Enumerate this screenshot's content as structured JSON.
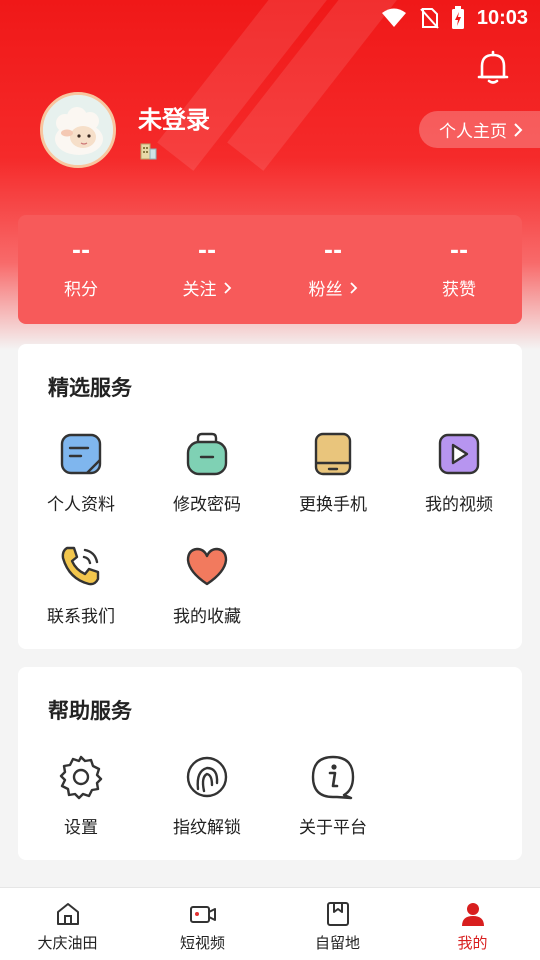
{
  "status_bar": {
    "time": "10:03"
  },
  "profile": {
    "username": "未登录",
    "homepage_label": "个人主页"
  },
  "stats": [
    {
      "value": "--",
      "label": "积分"
    },
    {
      "value": "--",
      "label": "关注"
    },
    {
      "value": "--",
      "label": "粉丝"
    },
    {
      "value": "--",
      "label": "获赞"
    }
  ],
  "featured": {
    "title": "精选服务",
    "items": [
      {
        "label": "个人资料",
        "icon": "profile-card-icon"
      },
      {
        "label": "修改密码",
        "icon": "password-lock-icon"
      },
      {
        "label": "更换手机",
        "icon": "phone-icon"
      },
      {
        "label": "我的视频",
        "icon": "video-play-icon"
      },
      {
        "label": "联系我们",
        "icon": "phone-call-icon"
      },
      {
        "label": "我的收藏",
        "icon": "heart-icon"
      }
    ]
  },
  "help": {
    "title": "帮助服务",
    "items": [
      {
        "label": "设置",
        "icon": "settings-gear-icon"
      },
      {
        "label": "指纹解锁",
        "icon": "fingerprint-icon"
      },
      {
        "label": "关于平台",
        "icon": "info-icon"
      }
    ]
  },
  "tabbar": {
    "items": [
      {
        "label": "大庆油田",
        "icon": "home-icon"
      },
      {
        "label": "短视频",
        "icon": "video-camera-icon"
      },
      {
        "label": "自留地",
        "icon": "bookmark-icon"
      },
      {
        "label": "我的",
        "icon": "user-icon",
        "active": true
      }
    ],
    "active_color": "#d81e1e"
  },
  "colors": {
    "brand_red": "#f01818",
    "card_bg": "#ffffff",
    "page_bg": "#f4f4f4"
  }
}
